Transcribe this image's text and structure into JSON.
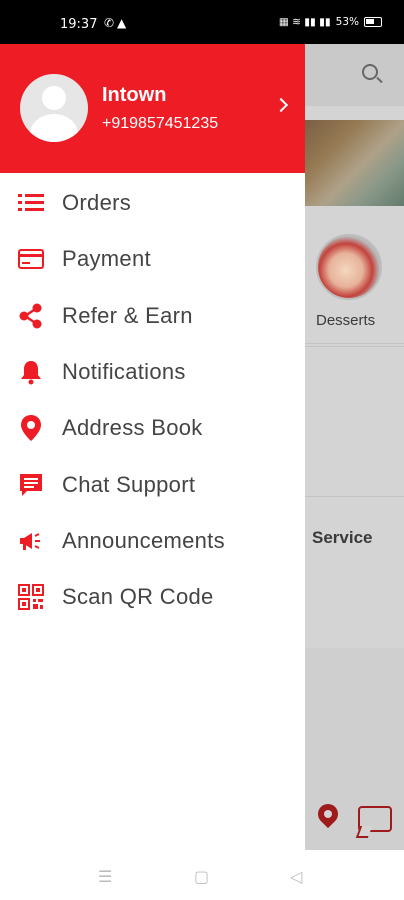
{
  "status_bar": {
    "time": "19:37",
    "battery": "53%"
  },
  "drawer": {
    "header": {
      "name": "Intown",
      "phone": "+919857451235"
    },
    "menu": [
      {
        "label": "Orders",
        "icon": "list-icon"
      },
      {
        "label": "Payment",
        "icon": "credit-card-icon"
      },
      {
        "label": "Refer & Earn",
        "icon": "share-icon"
      },
      {
        "label": "Notifications",
        "icon": "bell-icon"
      },
      {
        "label": "Address Book",
        "icon": "location-pin-icon"
      },
      {
        "label": "Chat Support",
        "icon": "chat-icon"
      },
      {
        "label": "Announcements",
        "icon": "megaphone-icon"
      },
      {
        "label": "Scan QR Code",
        "icon": "qr-code-icon"
      }
    ],
    "accent_color": "#ee1c24"
  },
  "background": {
    "category_label": "Desserts",
    "section_label": "Service"
  }
}
